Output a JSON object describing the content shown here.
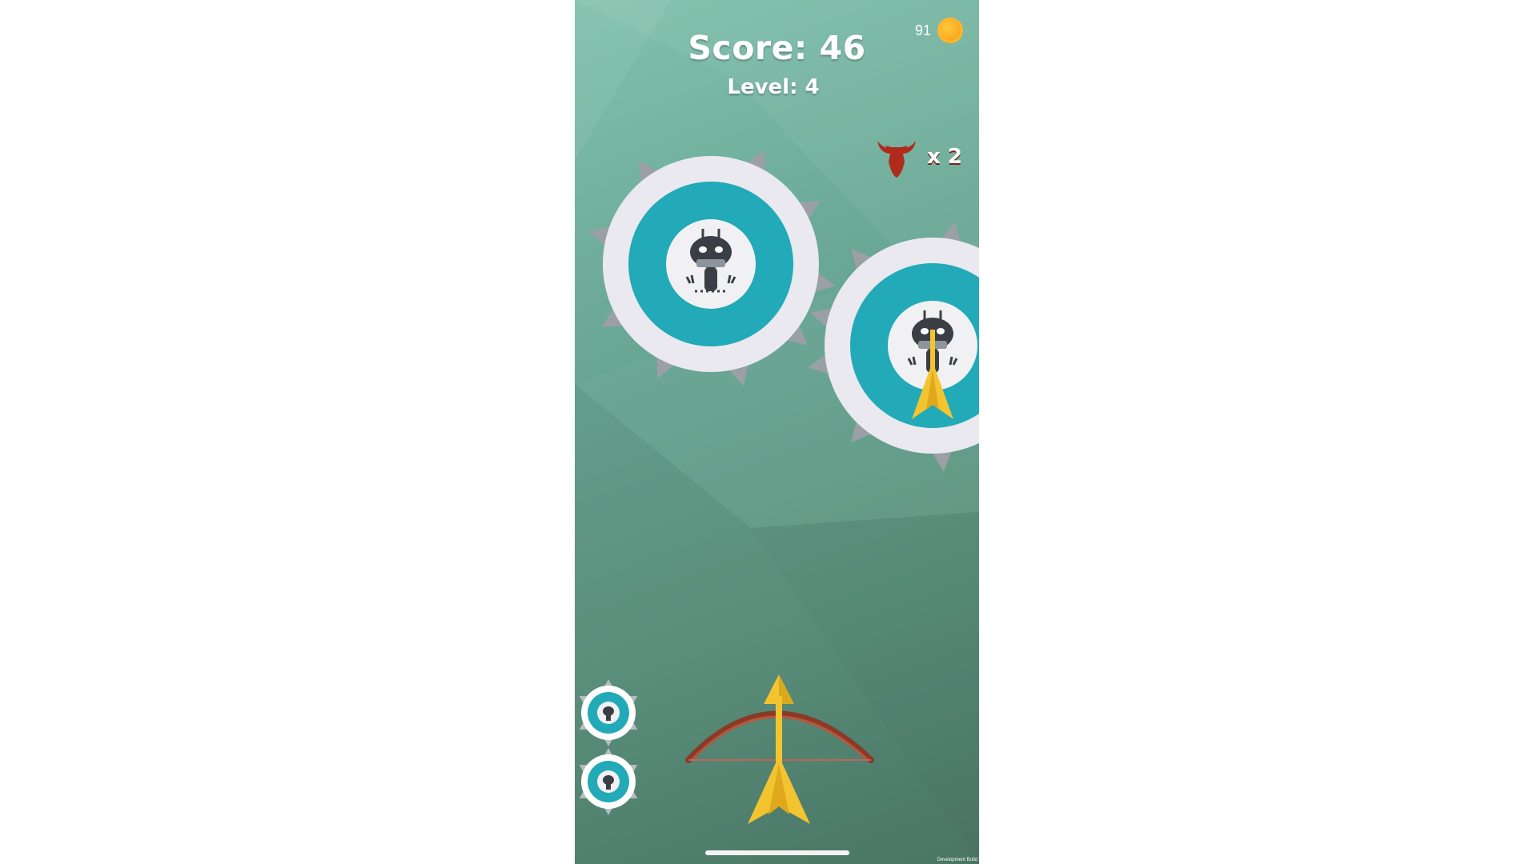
{
  "hud": {
    "score_label": "Score: 46",
    "level_label": "Level: 4",
    "coins": "91",
    "multiplier": "x 2",
    "multiplier_icon": "bull-head-icon"
  },
  "footer": {
    "build_label": "Development Build"
  },
  "colors": {
    "background": "#67a492",
    "target_ring": "#22aab8",
    "target_outer": "#e9e9ef",
    "arrow_gold": "#f2c430",
    "bow_wood": "#8a3a26",
    "bull_red": "#b02a1e",
    "coin": "#f7a51e"
  },
  "targets_remaining": 2
}
